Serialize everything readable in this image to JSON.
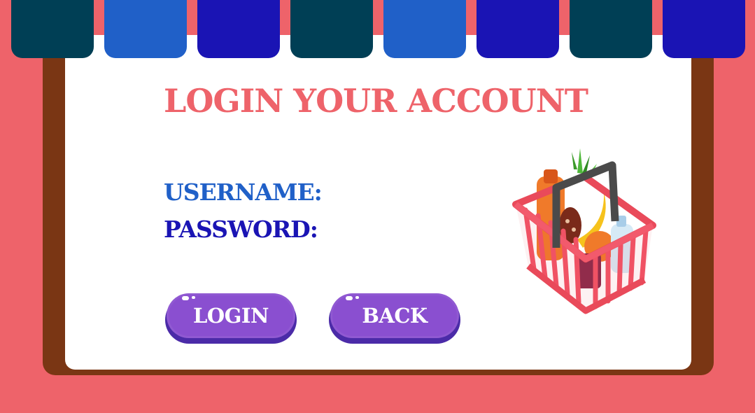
{
  "colors": {
    "background": "#ee636a",
    "frame": "#7a3614",
    "panel": "#ffffff",
    "title": "#ee636a",
    "username_label": "#2060c8",
    "password_label": "#1a14b4",
    "button_face": "#8a4fd0",
    "button_base": "#4b2ba8",
    "awning_stripes": [
      "#003f55",
      "#2060c8",
      "#1a14b4",
      "#003f55",
      "#2060c8",
      "#1a14b4",
      "#003f55",
      "#1a14b4"
    ]
  },
  "title": "LOGIN YOUR ACCOUNT",
  "form": {
    "username_label": "USERNAME:",
    "password_label": "PASSWORD:"
  },
  "buttons": {
    "login": "LOGIN",
    "back": "BACK"
  },
  "icons": {
    "basket": "grocery-basket-icon"
  }
}
